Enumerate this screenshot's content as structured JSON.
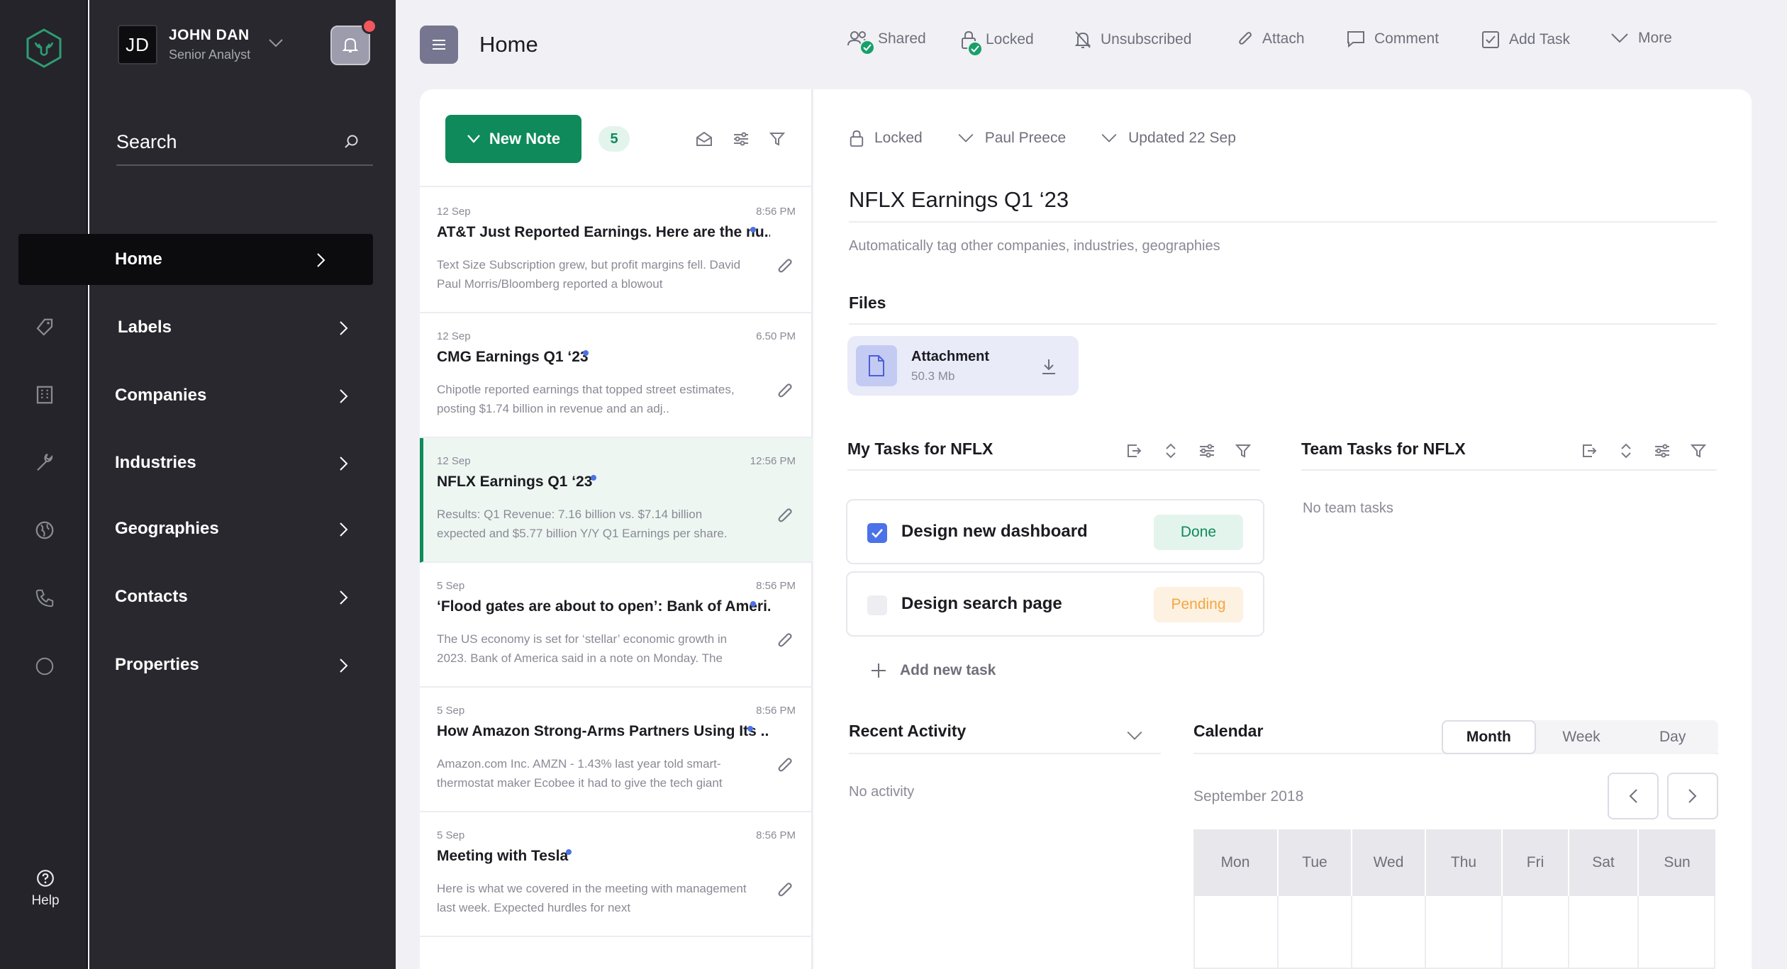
{
  "user": {
    "initials": "JD",
    "name": "JOHN DAN",
    "role": "Senior Analyst"
  },
  "search": {
    "label": "Search"
  },
  "nav": [
    {
      "label": "Home",
      "icon": "home-icon",
      "active": true
    },
    {
      "label": "Labels",
      "icon": "tag-icon"
    },
    {
      "label": "Companies",
      "icon": "building-icon"
    },
    {
      "label": "Industries",
      "icon": "wrench-icon"
    },
    {
      "label": "Geographies",
      "icon": "globe-icon"
    },
    {
      "label": "Contacts",
      "icon": "phone-icon"
    },
    {
      "label": "Properties",
      "icon": "circle-icon"
    }
  ],
  "help": {
    "label": "Help"
  },
  "header": {
    "title": "Home",
    "actions": [
      {
        "label": "Shared",
        "icon": "users-icon"
      },
      {
        "label": "Locked",
        "icon": "lock-icon"
      },
      {
        "label": "Unsubscribed",
        "icon": "bell-off-icon"
      },
      {
        "label": "Attach",
        "icon": "paperclip-icon"
      },
      {
        "label": "Comment",
        "icon": "comment-icon"
      },
      {
        "label": "Add Task",
        "icon": "checkbox-icon"
      },
      {
        "label": "More",
        "icon": "chevron-down-icon"
      }
    ]
  },
  "notes_panel": {
    "new_note_label": "New Note",
    "count": "5",
    "notes": [
      {
        "date": "12 Sep",
        "time": "8:56 PM",
        "title": "AT&T Just Reported Earnings. Here are the nu..",
        "body": "Text Size Subscription grew, but profit margins fell. David Paul Morris/Bloomberg reported a blowout"
      },
      {
        "date": "12 Sep",
        "time": "6.50 PM",
        "title": "CMG Earnings Q1 ‘23",
        "body": "Chipotle reported earnings that topped street estimates, posting $1.74 billion in revenue and an adj.."
      },
      {
        "date": "12 Sep",
        "time": "12:56 PM",
        "title": "NFLX Earnings Q1 ‘23",
        "body": "Results: Q1 Revenue: 7.16 billion vs. $7.14 billion expected and $5.77 billion Y/Y Q1 Earnings per share."
      },
      {
        "date": "5 Sep",
        "time": "8:56 PM",
        "title": "‘Flood gates are about to open’: Bank of Ameri..",
        "body": "The US economy is set for ‘stellar’ economic growth in 2023. Bank of America said in a note on Monday. The"
      },
      {
        "date": "5 Sep",
        "time": "8:56 PM",
        "title": "How Amazon Strong-Arms Partners Using Its ..",
        "body": "Amazon.com Inc. AMZN - 1.43% last year told smart-thermostat maker Ecobee it had to give the tech giant"
      },
      {
        "date": "5 Sep",
        "time": "8:56 PM",
        "title": "Meeting with Tesla",
        "body": "Here is what we covered in the meeting with management last week. Expected hurdles for next"
      }
    ]
  },
  "detail": {
    "meta": {
      "locked": "Locked",
      "author": "Paul Preece",
      "updated": "Updated 22 Sep"
    },
    "title": "NFLX Earnings Q1 ‘23",
    "subtitle": "Automatically tag other companies, industries, geographies",
    "files_heading": "Files",
    "file": {
      "name": "Attachment",
      "size": "50.3 Mb"
    },
    "my_tasks_heading": "My Tasks for NFLX",
    "team_tasks_heading": "Team Tasks for NFLX",
    "tasks": [
      {
        "label": "Design new dashboard",
        "status": "Done",
        "checked": true
      },
      {
        "label": "Design search page",
        "status": "Pending",
        "checked": false
      }
    ],
    "add_task_label": "Add new task",
    "no_team_tasks": "No team tasks",
    "recent_activity_heading": "Recent Activity",
    "no_activity": "No activity",
    "calendar": {
      "heading": "Calendar",
      "views": [
        "Month",
        "Week",
        "Day"
      ],
      "active_view": "Month",
      "month_label": "September 2018",
      "weekdays": [
        "Mon",
        "Tue",
        "Wed",
        "Thu",
        "Fri",
        "Sat",
        "Sun"
      ]
    }
  },
  "colors": {
    "accent": "#0f8a5a",
    "pending": "#f4a640",
    "notification": "#f2575d"
  }
}
